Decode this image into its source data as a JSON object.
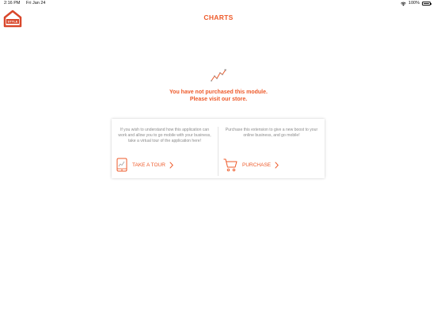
{
  "status_bar": {
    "time": "2:16 PM",
    "date": "Fri Jan 24",
    "battery": "100%"
  },
  "header": {
    "title": "CHARTS",
    "logo_text": "STYLE"
  },
  "notice": {
    "line1": "You have not purchased this module.",
    "line2": "Please visit our store."
  },
  "tour_panel": {
    "text": "If you wish to understand how this application can work and allow you to go mobile with your business, take a virtual tour of the application here!",
    "button_label": "TAKE A TOUR"
  },
  "purchase_panel": {
    "text": "Purchase this extension to give a new boost to your online business, and go mobile!",
    "button_label": "PURCHASE"
  },
  "icons": [
    "wifi-icon",
    "battery-icon",
    "store-logo-icon",
    "line-chart-icon",
    "tablet-icon",
    "cart-icon",
    "chevron-right-icon"
  ],
  "colors": {
    "accent": "#ee5a2a",
    "text_muted": "#8a8a8a",
    "background": "#ffffff"
  }
}
